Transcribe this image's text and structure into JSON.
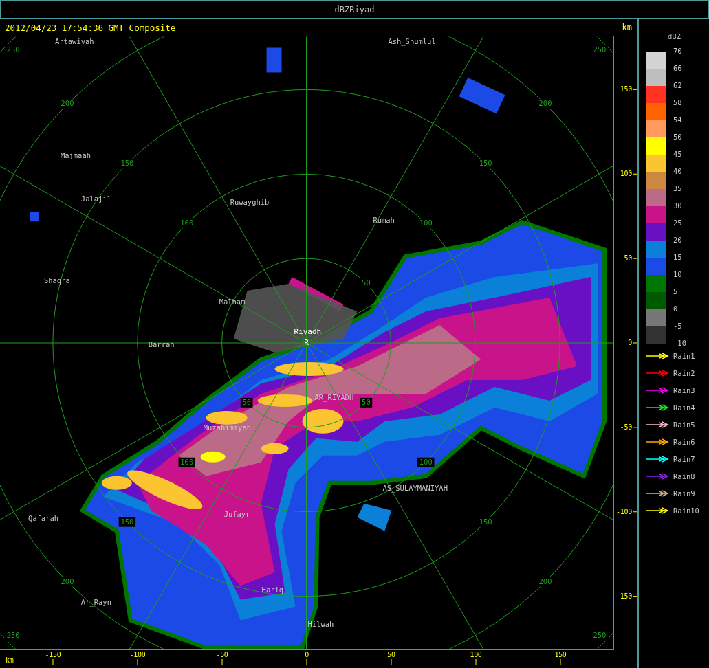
{
  "window": {
    "title": "dBZRiyad"
  },
  "header": {
    "timestamp": "2012/04/23 17:54:36 GMT Composite",
    "unit": "km"
  },
  "radar_site": {
    "name": "Riyadh",
    "marker": "R"
  },
  "places": [
    {
      "name": "Artawiyah"
    },
    {
      "name": "Ash_Shumlul"
    },
    {
      "name": "Majmaah"
    },
    {
      "name": "Jalajil"
    },
    {
      "name": "Ruwayghib"
    },
    {
      "name": "Rumah"
    },
    {
      "name": "Shaqra"
    },
    {
      "name": "Malham"
    },
    {
      "name": "Barrah"
    },
    {
      "name": "AR_RIYADH"
    },
    {
      "name": "Muzahimiyah"
    },
    {
      "name": "AS_SULAYMANIYAH"
    },
    {
      "name": "Jufayr"
    },
    {
      "name": "Qafarah"
    },
    {
      "name": "Ar_Rayn"
    },
    {
      "name": "Hariq"
    },
    {
      "name": "Hilwah"
    }
  ],
  "range_rings": [
    {
      "labels": [
        "50",
        "50",
        "50"
      ]
    },
    {
      "labels": [
        "100",
        "100",
        "100",
        "100"
      ]
    },
    {
      "labels": [
        "150",
        "150",
        "150",
        "150"
      ]
    },
    {
      "labels": [
        "200",
        "200",
        "200",
        "200"
      ]
    },
    {
      "labels": [
        "250",
        "250",
        "250",
        "250"
      ]
    }
  ],
  "y_axis": {
    "ticks": [
      "150",
      "100",
      "50",
      "0",
      "-50",
      "-100",
      "-150"
    ]
  },
  "x_axis": {
    "unit": "km",
    "ticks": [
      "-150",
      "-100",
      "-50",
      "0",
      "50",
      "100",
      "150"
    ]
  },
  "legend": {
    "unit": "dBZ",
    "swatches": [
      {
        "color": "#d3d3d3"
      },
      {
        "color": "#bebebe"
      },
      {
        "color": "#ff3322"
      },
      {
        "color": "#ff6000"
      },
      {
        "color": "#ff9a5c"
      },
      {
        "color": "#ffff00"
      },
      {
        "color": "#fbc532"
      },
      {
        "color": "#cd8740"
      },
      {
        "color": "#bb6a88"
      },
      {
        "color": "#c8138a"
      },
      {
        "color": "#6a10c4"
      },
      {
        "color": "#0a80d8"
      },
      {
        "color": "#1b4ae6"
      },
      {
        "color": "#007700"
      },
      {
        "color": "#005a00"
      },
      {
        "color": "#777777"
      },
      {
        "color": "#333333"
      }
    ],
    "ticks": [
      "70",
      "66",
      "62",
      "58",
      "54",
      "50",
      "45",
      "40",
      "35",
      "30",
      "25",
      "20",
      "15",
      "10",
      "5",
      "0",
      "-5",
      "-10"
    ]
  },
  "tracks": [
    {
      "label": "Rain1",
      "color": "#ffff00"
    },
    {
      "label": "Rain2",
      "color": "#ff0000"
    },
    {
      "label": "Rain3",
      "color": "#ff00ff"
    },
    {
      "label": "Rain4",
      "color": "#22ee22"
    },
    {
      "label": "Rain5",
      "color": "#ffc0cb"
    },
    {
      "label": "Rain6",
      "color": "#ffa500"
    },
    {
      "label": "Rain7",
      "color": "#00ffff"
    },
    {
      "label": "Rain8",
      "color": "#9020f0"
    },
    {
      "label": "Rain9",
      "color": "#d2b48c"
    },
    {
      "label": "Rain10",
      "color": "#ffff00"
    }
  ]
}
